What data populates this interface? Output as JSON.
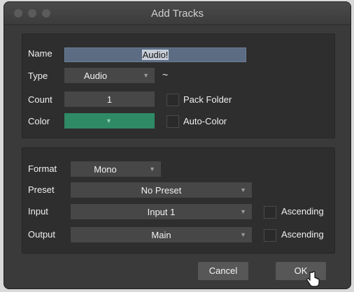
{
  "window": {
    "title": "Add Tracks"
  },
  "track": {
    "name_label": "Name",
    "name_value": "Audio!",
    "type_label": "Type",
    "type_value": "Audio",
    "type_icon": "~",
    "count_label": "Count",
    "count_value": "1",
    "pack_folder_label": "Pack Folder",
    "color_label": "Color",
    "color_value_hex": "#2f8a66",
    "auto_color_label": "Auto-Color"
  },
  "io": {
    "format_label": "Format",
    "format_value": "Mono",
    "preset_label": "Preset",
    "preset_value": "No Preset",
    "input_label": "Input",
    "input_value": "Input 1",
    "input_ascending_label": "Ascending",
    "output_label": "Output",
    "output_value": "Main",
    "output_ascending_label": "Ascending"
  },
  "buttons": {
    "cancel": "Cancel",
    "ok": "OK"
  },
  "colors": {
    "window_bg": "#3a3a3a",
    "panel_bg": "#2e2e2e",
    "field_bg": "#474747",
    "accent_green": "#2f8a66"
  }
}
